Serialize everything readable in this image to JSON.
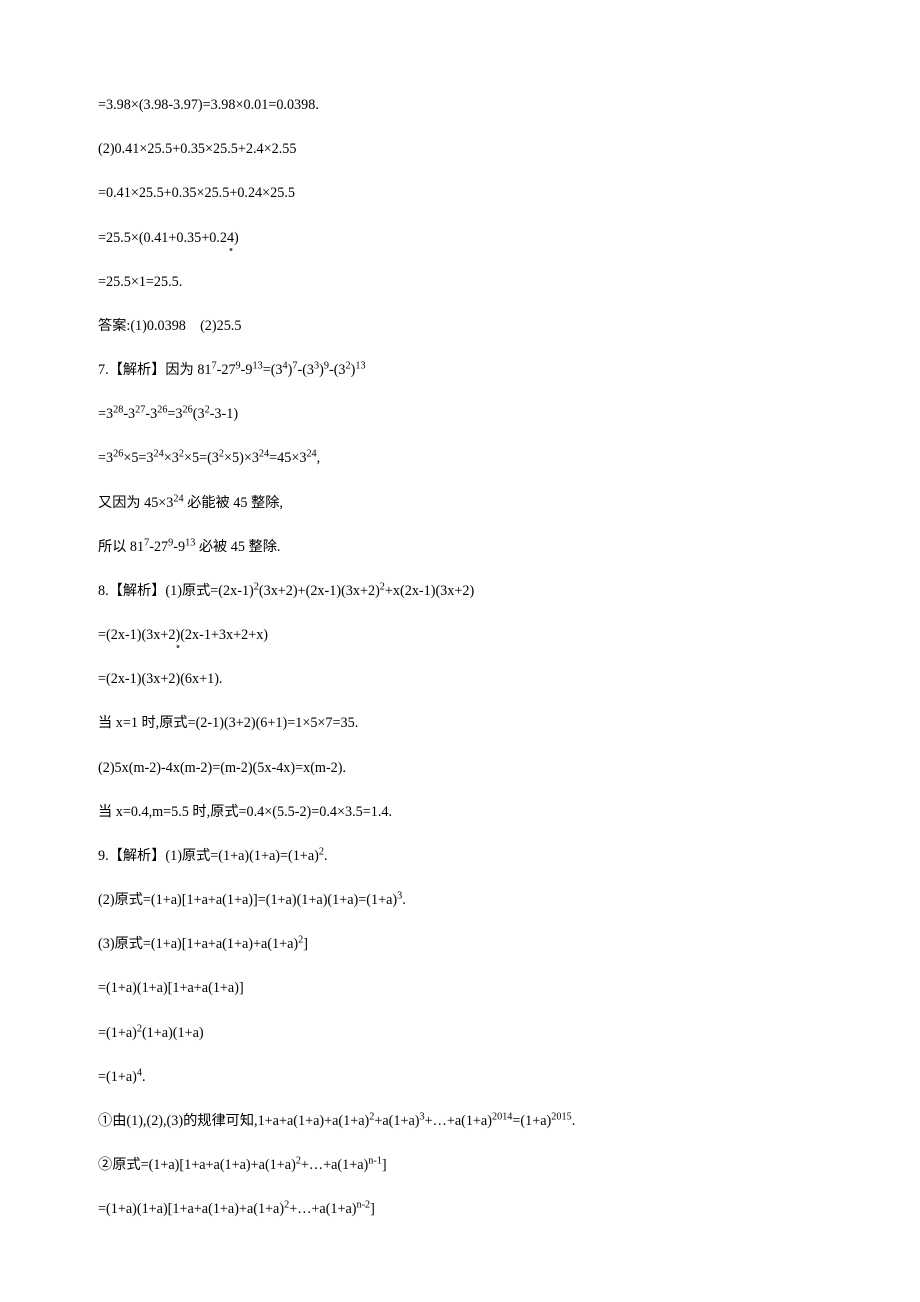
{
  "lines": {
    "l01": "=3.98×(3.98-3.97)=3.98×0.01=0.0398.",
    "l02": "(2)0.41×25.5+0.35×25.5+2.4×2.55",
    "l03": "=0.41×25.5+0.35×25.5+0.24×25.5",
    "l04_a": "=25.5×(0.41+0.35+0.2",
    "l04_b": "4",
    "l04_c": ")",
    "l05": "=25.5×1=25.5.",
    "l06": "答案:(1)0.0398　(2)25.5",
    "l07_a": "7.【解析】因为 81",
    "l07_s1": "7",
    "l07_b": "-27",
    "l07_s2": "9",
    "l07_c": "-9",
    "l07_s3": "13",
    "l07_d": "=(3",
    "l07_s4": "4",
    "l07_e": ")",
    "l07_s5": "7",
    "l07_f": "-(3",
    "l07_s6": "3",
    "l07_g": ")",
    "l07_s7": "9",
    "l07_h": "-(3",
    "l07_s8": "2",
    "l07_i": ")",
    "l07_s9": "13",
    "l08_a": "=3",
    "l08_s1": "28",
    "l08_b": "-3",
    "l08_s2": "27",
    "l08_c": "-3",
    "l08_s3": "26",
    "l08_d": "=3",
    "l08_s4": "26",
    "l08_e": "(3",
    "l08_s5": "2",
    "l08_f": "-3-1)",
    "l09_a": "=3",
    "l09_s1": "26",
    "l09_b": "×5=3",
    "l09_s2": "24",
    "l09_c": "×3",
    "l09_s3": "2",
    "l09_d": "×5=(3",
    "l09_s4": "2",
    "l09_e": "×5)×3",
    "l09_s5": "24",
    "l09_f": "=45×3",
    "l09_s6": "24",
    "l09_g": ",",
    "l10_a": "又因为 45×3",
    "l10_s1": "24",
    "l10_b": " 必能被 45 整除,",
    "l11_a": "所以 81",
    "l11_s1": "7",
    "l11_b": "-27",
    "l11_s2": "9",
    "l11_c": "-9",
    "l11_s3": "13",
    "l11_d": " 必被 45 整除.",
    "l12_a": "8.【解析】(1)原式=(2x-1)",
    "l12_s1": "2",
    "l12_b": "(3x+2)+(2x-1)(3x+2)",
    "l12_s2": "2",
    "l12_c": "+x(2x-1)(3x+2)",
    "l13_a": "=(2x-1)(3x+2",
    "l13_b": ")",
    "l13_c": "(2x-1+3x+2+x)",
    "l14": "=(2x-1)(3x+2)(6x+1).",
    "l15": "当 x=1 时,原式=(2-1)(3+2)(6+1)=1×5×7=35.",
    "l16": "(2)5x(m-2)-4x(m-2)=(m-2)(5x-4x)=x(m-2).",
    "l17": "当 x=0.4,m=5.5 时,原式=0.4×(5.5-2)=0.4×3.5=1.4.",
    "l18_a": "9.【解析】(1)原式=(1+a)(1+a)=(1+a)",
    "l18_s1": "2",
    "l18_b": ".",
    "l19_a": "(2)原式=(1+a)[1+a+a(1+a)]=(1+a)(1+a)(1+a)=(1+a)",
    "l19_s1": "3",
    "l19_b": ".",
    "l20_a": "(3)原式=(1+a)[1+a+a(1+a)+a(1+a)",
    "l20_s1": "2",
    "l20_b": "]",
    "l21": "=(1+a)(1+a)[1+a+a(1+a)]",
    "l22_a": "=(1+a)",
    "l22_s1": "2",
    "l22_b": "(1+a)(1+a)",
    "l23_a": "=(1+a)",
    "l23_s1": "4",
    "l23_b": ".",
    "l24_a": "①由(1),(2),(3)的规律可知,1+a+a(1+a)+a(1+a)",
    "l24_s1": "2",
    "l24_b": "+a(1+a)",
    "l24_s2": "3",
    "l24_c": "+…+a(1+a)",
    "l24_s3": "2014",
    "l24_d": "=(1+a)",
    "l24_s4": "2015",
    "l24_e": ".",
    "l25_a": "②原式=(1+a)[1+a+a(1+a)+a(1+a)",
    "l25_s1": "2",
    "l25_b": "+…+a(1+a)",
    "l25_s2": "n-1",
    "l25_c": "]",
    "l26_a": "=(1+a)(1+a)[1+a+a(1+a)+a(1+a)",
    "l26_s1": "2",
    "l26_b": "+…+a(1+a)",
    "l26_s2": "n-2",
    "l26_c": "]"
  }
}
